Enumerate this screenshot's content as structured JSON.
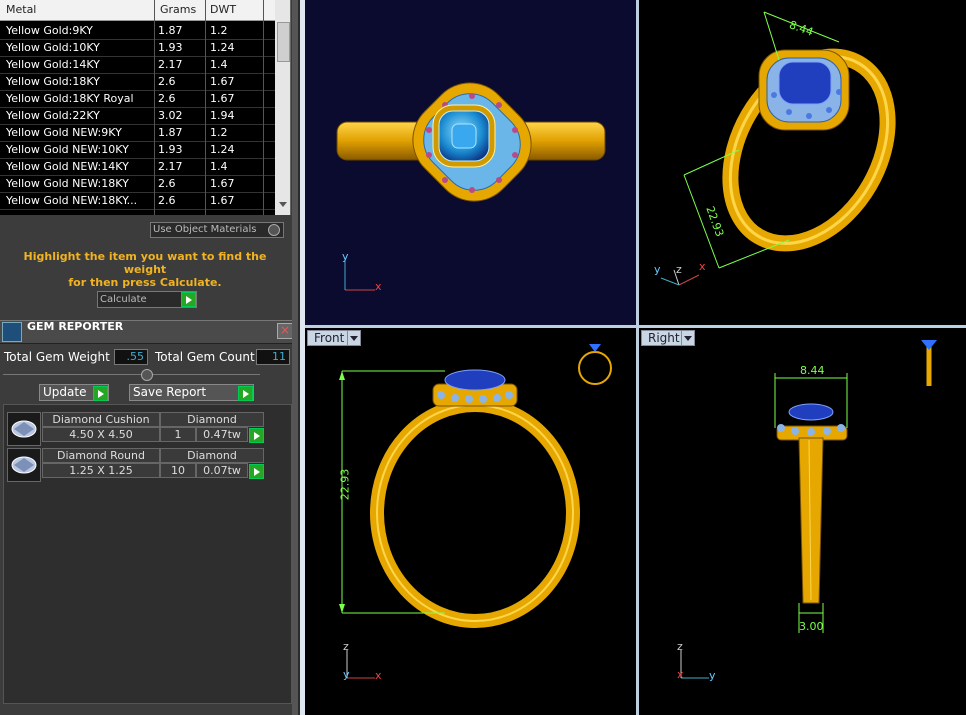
{
  "metal_table": {
    "columns": [
      "Metal",
      "Grams",
      "DWT"
    ],
    "rows": [
      [
        "Yellow Gold:9KY",
        "1.87",
        "1.2"
      ],
      [
        "Yellow Gold:10KY",
        "1.93",
        "1.24"
      ],
      [
        "Yellow Gold:14KY",
        "2.17",
        "1.4"
      ],
      [
        "Yellow Gold:18KY",
        "2.6",
        "1.67"
      ],
      [
        "Yellow Gold:18KY Royal",
        "2.6",
        "1.67"
      ],
      [
        "Yellow Gold:22KY",
        "3.02",
        "1.94"
      ],
      [
        "Yellow Gold NEW:9KY",
        "1.87",
        "1.2"
      ],
      [
        "Yellow Gold NEW:10KY",
        "1.93",
        "1.24"
      ],
      [
        "Yellow Gold NEW:14KY",
        "2.17",
        "1.4"
      ],
      [
        "Yellow Gold NEW:18KY",
        "2.6",
        "1.67"
      ],
      [
        "Yellow Gold NEW:18KY...",
        "2.6",
        "1.67"
      ]
    ]
  },
  "use_object_materials": "Use Object Materials",
  "hint_line1": "Highlight the item you want to find the weight",
  "hint_line2": "for then press Calculate.",
  "calculate_label": "Calculate",
  "gem_reporter": {
    "title": "GEM REPORTER",
    "total_weight_label": "Total Gem Weight",
    "total_weight_value": ".55",
    "total_count_label": "Total Gem Count",
    "total_count_value": "11",
    "update_label": "Update",
    "save_report_label": "Save Report",
    "gems": [
      {
        "name": "Diamond Cushion",
        "size": "4.50 X 4.50",
        "material": "Diamond",
        "count": "1",
        "weight": "0.47tw"
      },
      {
        "name": "Diamond Round",
        "size": "1.25 X 1.25",
        "material": "Diamond",
        "count": "10",
        "weight": "0.07tw"
      }
    ]
  },
  "viewports": {
    "front_tab": "Front",
    "right_tab": "Right",
    "dim_front_height": "22.93",
    "dim_right_width": "8.44",
    "dim_right_shank": "3.00",
    "dim_persp_top": "8.44",
    "dim_persp_side": "22.93"
  },
  "axes": {
    "x": "x",
    "y": "y",
    "z": "z"
  },
  "colors": {
    "gold": "#e6a800",
    "gem_blue": "#1f3fbf",
    "dimension_green": "#7cff4a",
    "hint_orange": "#f1b321"
  }
}
